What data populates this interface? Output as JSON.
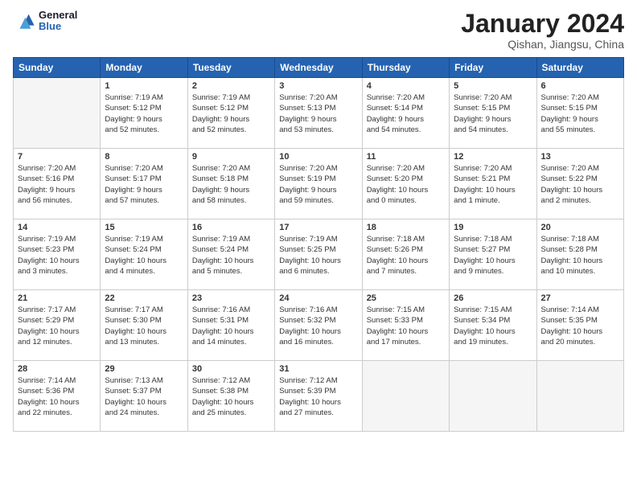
{
  "header": {
    "logo": {
      "line1": "General",
      "line2": "Blue"
    },
    "title": "January 2024",
    "location": "Qishan, Jiangsu, China"
  },
  "days_of_week": [
    "Sunday",
    "Monday",
    "Tuesday",
    "Wednesday",
    "Thursday",
    "Friday",
    "Saturday"
  ],
  "weeks": [
    [
      {
        "day": "",
        "info": ""
      },
      {
        "day": "1",
        "info": "Sunrise: 7:19 AM\nSunset: 5:12 PM\nDaylight: 9 hours\nand 52 minutes."
      },
      {
        "day": "2",
        "info": "Sunrise: 7:19 AM\nSunset: 5:12 PM\nDaylight: 9 hours\nand 52 minutes."
      },
      {
        "day": "3",
        "info": "Sunrise: 7:20 AM\nSunset: 5:13 PM\nDaylight: 9 hours\nand 53 minutes."
      },
      {
        "day": "4",
        "info": "Sunrise: 7:20 AM\nSunset: 5:14 PM\nDaylight: 9 hours\nand 54 minutes."
      },
      {
        "day": "5",
        "info": "Sunrise: 7:20 AM\nSunset: 5:15 PM\nDaylight: 9 hours\nand 54 minutes."
      },
      {
        "day": "6",
        "info": "Sunrise: 7:20 AM\nSunset: 5:15 PM\nDaylight: 9 hours\nand 55 minutes."
      }
    ],
    [
      {
        "day": "7",
        "info": "Sunrise: 7:20 AM\nSunset: 5:16 PM\nDaylight: 9 hours\nand 56 minutes."
      },
      {
        "day": "8",
        "info": "Sunrise: 7:20 AM\nSunset: 5:17 PM\nDaylight: 9 hours\nand 57 minutes."
      },
      {
        "day": "9",
        "info": "Sunrise: 7:20 AM\nSunset: 5:18 PM\nDaylight: 9 hours\nand 58 minutes."
      },
      {
        "day": "10",
        "info": "Sunrise: 7:20 AM\nSunset: 5:19 PM\nDaylight: 9 hours\nand 59 minutes."
      },
      {
        "day": "11",
        "info": "Sunrise: 7:20 AM\nSunset: 5:20 PM\nDaylight: 10 hours\nand 0 minutes."
      },
      {
        "day": "12",
        "info": "Sunrise: 7:20 AM\nSunset: 5:21 PM\nDaylight: 10 hours\nand 1 minute."
      },
      {
        "day": "13",
        "info": "Sunrise: 7:20 AM\nSunset: 5:22 PM\nDaylight: 10 hours\nand 2 minutes."
      }
    ],
    [
      {
        "day": "14",
        "info": "Sunrise: 7:19 AM\nSunset: 5:23 PM\nDaylight: 10 hours\nand 3 minutes."
      },
      {
        "day": "15",
        "info": "Sunrise: 7:19 AM\nSunset: 5:24 PM\nDaylight: 10 hours\nand 4 minutes."
      },
      {
        "day": "16",
        "info": "Sunrise: 7:19 AM\nSunset: 5:24 PM\nDaylight: 10 hours\nand 5 minutes."
      },
      {
        "day": "17",
        "info": "Sunrise: 7:19 AM\nSunset: 5:25 PM\nDaylight: 10 hours\nand 6 minutes."
      },
      {
        "day": "18",
        "info": "Sunrise: 7:18 AM\nSunset: 5:26 PM\nDaylight: 10 hours\nand 7 minutes."
      },
      {
        "day": "19",
        "info": "Sunrise: 7:18 AM\nSunset: 5:27 PM\nDaylight: 10 hours\nand 9 minutes."
      },
      {
        "day": "20",
        "info": "Sunrise: 7:18 AM\nSunset: 5:28 PM\nDaylight: 10 hours\nand 10 minutes."
      }
    ],
    [
      {
        "day": "21",
        "info": "Sunrise: 7:17 AM\nSunset: 5:29 PM\nDaylight: 10 hours\nand 12 minutes."
      },
      {
        "day": "22",
        "info": "Sunrise: 7:17 AM\nSunset: 5:30 PM\nDaylight: 10 hours\nand 13 minutes."
      },
      {
        "day": "23",
        "info": "Sunrise: 7:16 AM\nSunset: 5:31 PM\nDaylight: 10 hours\nand 14 minutes."
      },
      {
        "day": "24",
        "info": "Sunrise: 7:16 AM\nSunset: 5:32 PM\nDaylight: 10 hours\nand 16 minutes."
      },
      {
        "day": "25",
        "info": "Sunrise: 7:15 AM\nSunset: 5:33 PM\nDaylight: 10 hours\nand 17 minutes."
      },
      {
        "day": "26",
        "info": "Sunrise: 7:15 AM\nSunset: 5:34 PM\nDaylight: 10 hours\nand 19 minutes."
      },
      {
        "day": "27",
        "info": "Sunrise: 7:14 AM\nSunset: 5:35 PM\nDaylight: 10 hours\nand 20 minutes."
      }
    ],
    [
      {
        "day": "28",
        "info": "Sunrise: 7:14 AM\nSunset: 5:36 PM\nDaylight: 10 hours\nand 22 minutes."
      },
      {
        "day": "29",
        "info": "Sunrise: 7:13 AM\nSunset: 5:37 PM\nDaylight: 10 hours\nand 24 minutes."
      },
      {
        "day": "30",
        "info": "Sunrise: 7:12 AM\nSunset: 5:38 PM\nDaylight: 10 hours\nand 25 minutes."
      },
      {
        "day": "31",
        "info": "Sunrise: 7:12 AM\nSunset: 5:39 PM\nDaylight: 10 hours\nand 27 minutes."
      },
      {
        "day": "",
        "info": ""
      },
      {
        "day": "",
        "info": ""
      },
      {
        "day": "",
        "info": ""
      }
    ]
  ]
}
